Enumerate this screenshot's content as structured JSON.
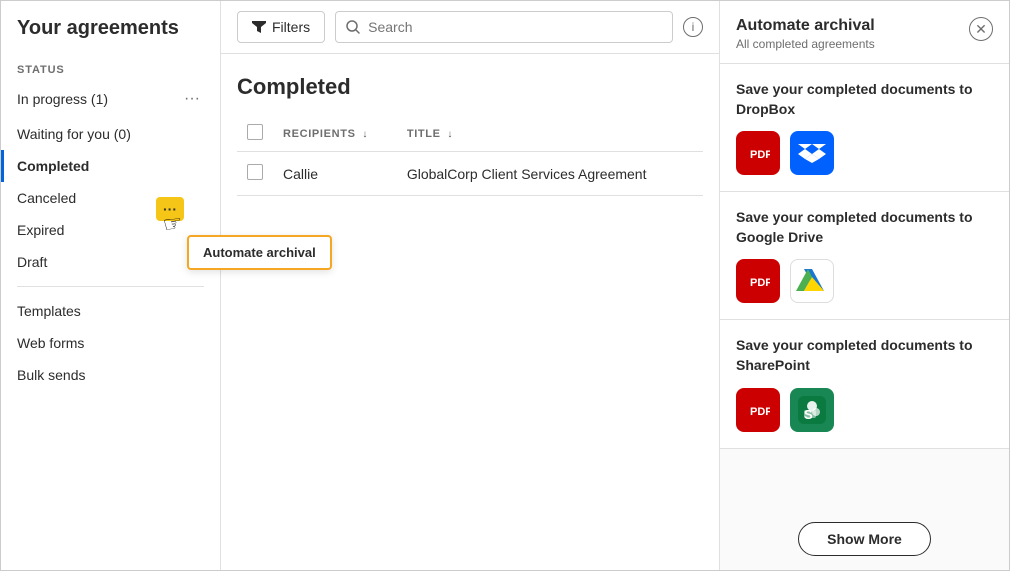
{
  "app": {
    "title": "Your agreements"
  },
  "sidebar": {
    "section_label": "STATUS",
    "items": [
      {
        "label": "In progress (1)",
        "has_dots": true,
        "active": false
      },
      {
        "label": "Waiting for you (0)",
        "has_dots": false,
        "active": false
      },
      {
        "label": "Completed",
        "has_dots": true,
        "active": true
      },
      {
        "label": "Canceled",
        "has_dots": false,
        "active": false
      },
      {
        "label": "Expired",
        "has_dots": false,
        "active": false
      },
      {
        "label": "Draft",
        "has_dots": false,
        "active": false
      }
    ],
    "bottom_items": [
      {
        "label": "Templates"
      },
      {
        "label": "Web forms"
      },
      {
        "label": "Bulk sends"
      }
    ]
  },
  "header": {
    "filter_label": "Filters",
    "search_placeholder": "Search",
    "info_label": "i"
  },
  "main": {
    "section_title": "Completed",
    "table": {
      "columns": [
        "",
        "RECIPIENTS",
        "TITLE"
      ],
      "rows": [
        {
          "recipient": "Callie",
          "title": "GlobalCorp Client Services Agreement"
        }
      ]
    }
  },
  "right_panel": {
    "title": "Automate archival",
    "subtitle": "All completed agreements",
    "cards": [
      {
        "title": "Save your completed documents to DropBox",
        "icons": [
          "adobe",
          "dropbox"
        ]
      },
      {
        "title": "Save your completed documents to Google Drive",
        "icons": [
          "adobe",
          "gdrive"
        ]
      },
      {
        "title": "Save your completed documents to SharePoint",
        "icons": [
          "adobe",
          "sharepoint"
        ]
      }
    ],
    "show_more_label": "Show More"
  },
  "tooltip": {
    "label": "Automate archival"
  },
  "automate_btn": {
    "dots_label": "⋯"
  }
}
